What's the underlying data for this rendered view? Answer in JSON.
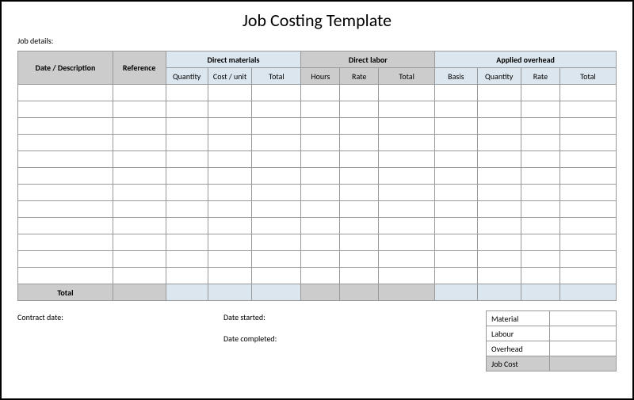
{
  "title": "Job Costing Template",
  "job_details_label": "Job details:",
  "headers": {
    "date_desc": "Date / Description",
    "reference": "Reference",
    "direct_materials": "Direct materials",
    "direct_labor": "Direct labor",
    "applied_overhead": "Applied overhead"
  },
  "subheaders": {
    "dm_quantity": "Quantity",
    "dm_cost_unit": "Cost / unit",
    "dm_total": "Total",
    "dl_hours": "Hours",
    "dl_rate": "Rate",
    "dl_total": "Total",
    "ao_basis": "Basis",
    "ao_quantity": "Quantity",
    "ao_rate": "Rate",
    "ao_total": "Total"
  },
  "total_label": "Total",
  "footer": {
    "contract_date": "Contract date:",
    "date_started": "Date started:",
    "date_completed": "Date completed:"
  },
  "summary": {
    "material": "Material",
    "labour": "Labour",
    "overhead": "Overhead",
    "job_cost": "Job Cost"
  }
}
